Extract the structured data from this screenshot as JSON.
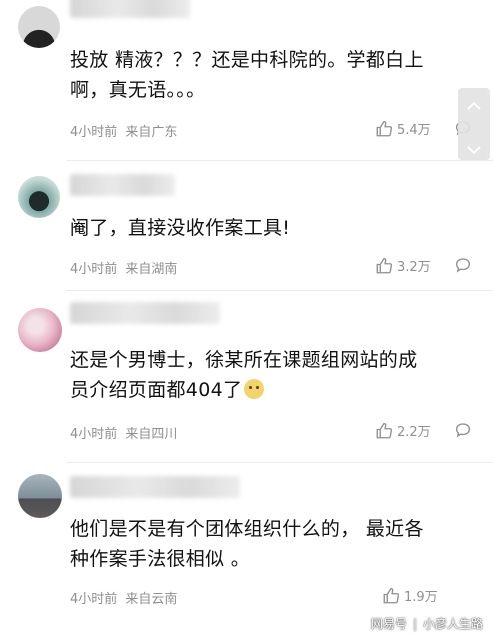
{
  "comments": [
    {
      "text_line1": "投放 精液？？？还是中科院的。学都白上",
      "text_line2": "啊，真无语。。。",
      "time": "4小时前",
      "location": "来自广东",
      "likes": "5.4万"
    },
    {
      "text_line1": "阉了，直接没收作案工具!",
      "time": "4小时前",
      "location": "来自湖南",
      "likes": "3.2万"
    },
    {
      "text_line1": "还是个男博士，徐某所在课题组网站的成",
      "text_line2": "员介绍页面都404了",
      "time": "4小时前",
      "location": "来自四川",
      "likes": "2.2万"
    },
    {
      "text_line1": "他们是不是有个团体组织什么的， 最近各",
      "text_line2": "种作案手法很相似 。",
      "time": "4小时前",
      "location": "来自云南",
      "likes": "1.9万"
    }
  ],
  "watermark": {
    "source": "网易号",
    "author": "小彦人生路"
  }
}
